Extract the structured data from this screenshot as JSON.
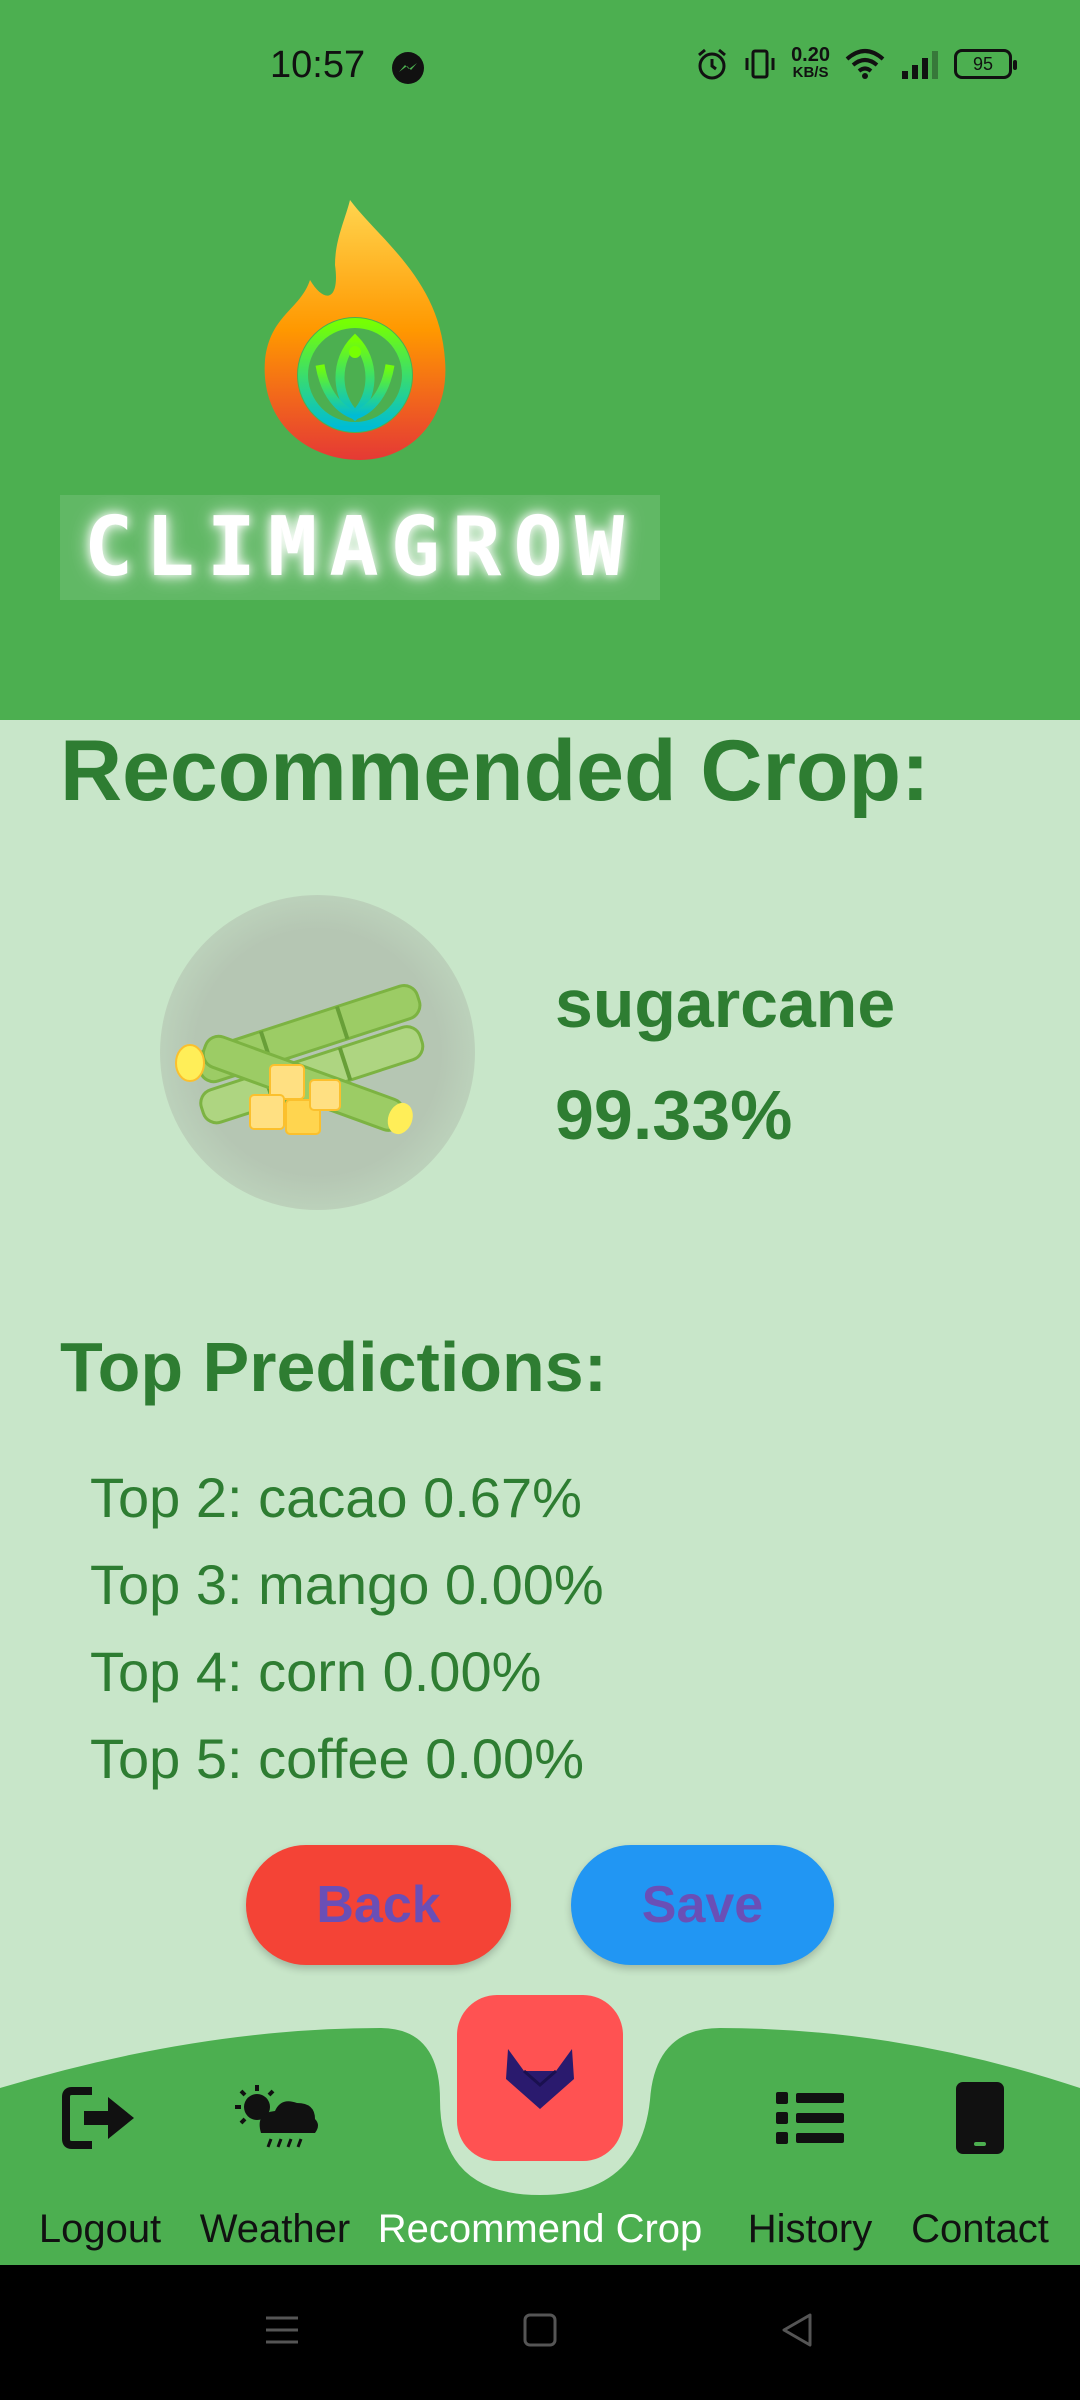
{
  "status_bar": {
    "time": "10:57",
    "speed_value": "0.20",
    "speed_unit": "KB/S",
    "battery": "95"
  },
  "header": {
    "brand": "CLIMAGROW"
  },
  "main": {
    "title": "Recommended Crop:",
    "crop_name": "sugarcane",
    "crop_percent": "99.33%",
    "top_title": "Top Predictions:",
    "predictions": [
      "Top 2: cacao 0.67%",
      "Top 3: mango 0.00%",
      "Top 4: corn 0.00%",
      "Top 5: coffee 0.00%"
    ],
    "back_label": "Back",
    "save_label": "Save"
  },
  "nav": {
    "items": [
      {
        "label": "Logout",
        "icon": "logout-icon"
      },
      {
        "label": "Weather",
        "icon": "weather-icon"
      },
      {
        "label": "Recommend Crop",
        "icon": "fox-icon"
      },
      {
        "label": "History",
        "icon": "list-icon"
      },
      {
        "label": "Contact",
        "icon": "phone-icon"
      }
    ]
  },
  "colors": {
    "primary": "#4caf50",
    "background": "#c8e6c9",
    "text_green": "#2e7d32",
    "back_button": "#f44336",
    "save_button": "#2196f3",
    "active_nav": "#ff5252"
  }
}
